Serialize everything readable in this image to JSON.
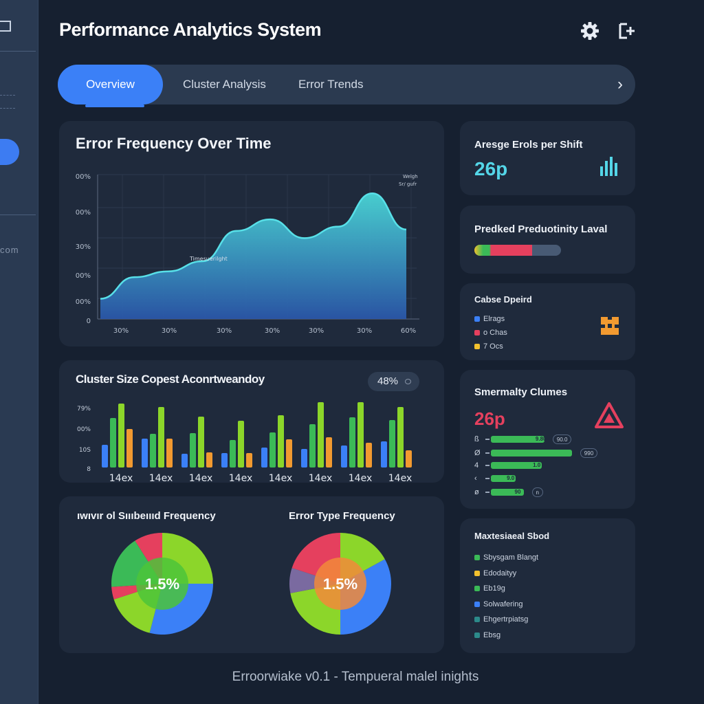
{
  "app": {
    "title": "Performance Analytics System",
    "footer": "Erroorwiake v0.1 - Tempueral malel inights"
  },
  "header": {
    "settings_icon": "gear-icon",
    "exit_icon": "exit-icon"
  },
  "sidebar": {
    "fragment_text": "com"
  },
  "tabs": [
    {
      "label": "Overview",
      "active": true
    },
    {
      "label": "Cluster Analysis",
      "active": false
    },
    {
      "label": "Error Trends",
      "active": false
    }
  ],
  "tab_next_glyph": "›",
  "line_chart": {
    "title": "Error Frequency Over Time",
    "annotation": "Timesuerilght",
    "corner_label": [
      "Welgh",
      "Sr/ gufr"
    ]
  },
  "bar_chart": {
    "title": "Cluster Size Copest Aconrtweandoy",
    "badge": "48%"
  },
  "pie_charts": {
    "left_title": "ıwıvır ol Sıııbeıııd Frequency",
    "left_center": "1.5%",
    "right_title": "Error Type Frequency",
    "right_center": "1.5%"
  },
  "stats": {
    "avg_errors": {
      "title": "Aresge Erols per Shift",
      "value": "26p",
      "icon": "bar-chart-icon"
    },
    "productivity": {
      "title": "Predked Preduotinity Laval",
      "level": 0.67
    },
    "cause": {
      "title": "Cabse Dpeird",
      "legend": [
        {
          "label": "Elrags",
          "color": "#3b80f7"
        },
        {
          "label": "o Chas",
          "color": "#e5405e"
        },
        {
          "label": "7 Ocs",
          "color": "#f2c12e"
        }
      ],
      "icon": "puzzle-icon"
    },
    "severity": {
      "title": "Smermalty Clumes",
      "value": "26p",
      "icon": "warning-icon",
      "rows": [
        {
          "label": "ß",
          "fraction": 0.41,
          "value": "9.80",
          "tag": "90.0"
        },
        {
          "label": "Ø",
          "fraction": 0.62,
          "value": "",
          "tag": "990"
        },
        {
          "label": "4",
          "fraction": 0.39,
          "value": "1.0",
          "tag": ""
        },
        {
          "label": "‹",
          "fraction": 0.19,
          "value": "9.0",
          "tag": ""
        },
        {
          "label": "ø",
          "fraction": 0.25,
          "value": "90",
          "tag": "n"
        }
      ]
    },
    "maxes": {
      "title": "Maxtesiaeal Sbod",
      "legend": [
        {
          "label": "Sbysgam Blangt",
          "color": "#3bba57"
        },
        {
          "label": "Edodaityy",
          "color": "#f2c12e"
        },
        {
          "label": "Eb19g",
          "color": "#3bba57"
        },
        {
          "label": "Solwafering",
          "color": "#3b80f7"
        },
        {
          "label": "Ehgertrpiatsg",
          "color": "#2c8a8a"
        },
        {
          "label": "Ebsg",
          "color": "#2c8a8a"
        }
      ]
    }
  },
  "chart_data": [
    {
      "type": "area",
      "title": "Error Frequency Over Time",
      "x": [
        "30%",
        "30%",
        "30%",
        "30%",
        "30%",
        "30%",
        "60%"
      ],
      "y_tick_labels": [
        "0",
        "00%",
        "00%",
        "30%",
        "00%",
        "00%"
      ],
      "values": [
        0.14,
        0.29,
        0.33,
        0.4,
        0.61,
        0.69,
        0.56,
        0.64,
        0.87,
        0.62
      ],
      "note": "",
      "color": "#3fb7c9"
    },
    {
      "type": "bar",
      "title": "Cluster Size Copest Aconrtweandoy",
      "categories": [
        "14ex",
        "14ex",
        "14ex",
        "14ex",
        "14ex",
        "14ex",
        "14ex",
        "14ex"
      ],
      "y_tick_labels": [
        "8",
        "10S",
        "00%",
        "79%"
      ],
      "series": [
        {
          "name": "",
          "color": "#3b80f7",
          "values": [
            33,
            42,
            20,
            21,
            29,
            27,
            32,
            38
          ]
        },
        {
          "name": "",
          "color": "#3bba57",
          "values": [
            72,
            49,
            50,
            40,
            51,
            63,
            73,
            69
          ]
        },
        {
          "name": "",
          "color": "#8cd62a",
          "values": [
            93,
            88,
            74,
            68,
            76,
            95,
            95,
            88
          ]
        },
        {
          "name": "",
          "color": "#f29a30",
          "values": [
            56,
            42,
            22,
            21,
            41,
            44,
            36,
            25
          ]
        }
      ]
    },
    {
      "type": "pie",
      "title": "ıwıvır ol Sıııbeıııd Frequency",
      "center_label": "1.5%",
      "slices": [
        {
          "color": "#8cd62a",
          "value": 25
        },
        {
          "color": "#3b80f7",
          "value": 29
        },
        {
          "color": "#8cd62a",
          "value": 16
        },
        {
          "color": "#e5405e",
          "value": 4
        },
        {
          "color": "#3bba57",
          "value": 17
        },
        {
          "color": "#e5405e",
          "value": 9
        }
      ]
    },
    {
      "type": "pie",
      "title": "Error Type Frequency",
      "center_label": "1.5%",
      "slices": [
        {
          "color": "#8cd62a",
          "value": 17
        },
        {
          "color": "#3b80f7",
          "value": 33
        },
        {
          "color": "#8cd62a",
          "value": 22
        },
        {
          "color": "#7a6aa0",
          "value": 8
        },
        {
          "color": "#e5405e",
          "value": 20
        }
      ]
    }
  ]
}
